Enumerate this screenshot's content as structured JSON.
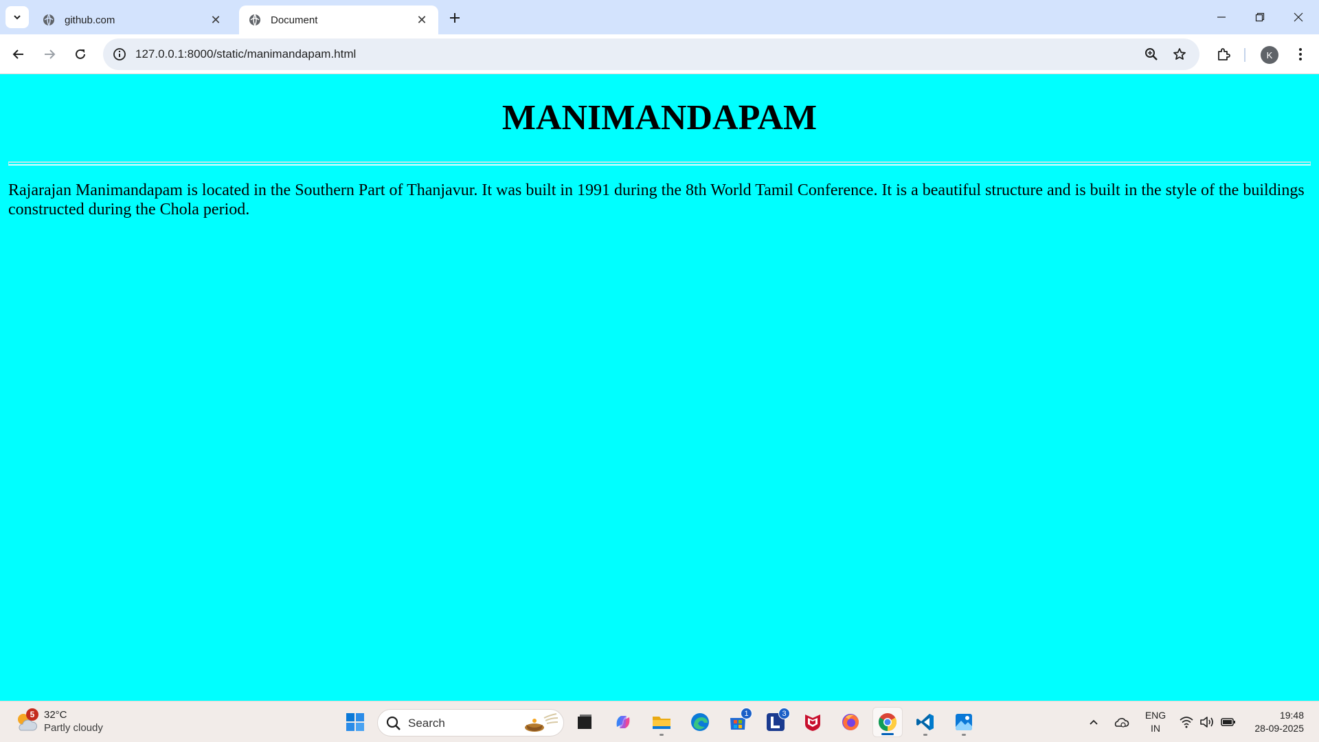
{
  "browser": {
    "tabs": [
      {
        "title": "github.com",
        "active": false
      },
      {
        "title": "Document",
        "active": true
      }
    ],
    "url": "127.0.0.1:8000/static/manimandapam.html",
    "profile_initial": "K"
  },
  "page": {
    "heading": "MANIMANDAPAM",
    "paragraph": "Rajarajan Manimandapam is located in the Southern Part of Thanjavur. It was built in 1991 during the 8th World Tamil Conference. It is a beautiful structure and is built in the style of the buildings constructed during the Chola period.",
    "background_color": "#00ffff"
  },
  "taskbar": {
    "weather": {
      "temp": "32°C",
      "desc": "Partly cloudy",
      "badge": "5"
    },
    "search_placeholder": "Search",
    "apps": [
      {
        "name": "start",
        "icon": "windows-logo-icon"
      },
      {
        "name": "task-view",
        "icon": "task-view-icon"
      },
      {
        "name": "copilot",
        "icon": "copilot-icon"
      },
      {
        "name": "file-explorer",
        "icon": "folder-icon"
      },
      {
        "name": "edge",
        "icon": "edge-icon"
      },
      {
        "name": "store",
        "icon": "store-icon",
        "badge": "1"
      },
      {
        "name": "l-app",
        "icon": "l-app-icon",
        "badge": "3"
      },
      {
        "name": "mcafee",
        "icon": "mcafee-icon"
      },
      {
        "name": "firefox",
        "icon": "firefox-icon"
      },
      {
        "name": "chrome",
        "icon": "chrome-icon"
      },
      {
        "name": "vscode",
        "icon": "vscode-icon"
      },
      {
        "name": "photos",
        "icon": "photos-icon"
      }
    ],
    "lang_line1": "ENG",
    "lang_line2": "IN",
    "time": "19:48",
    "date": "28-09-2025"
  }
}
